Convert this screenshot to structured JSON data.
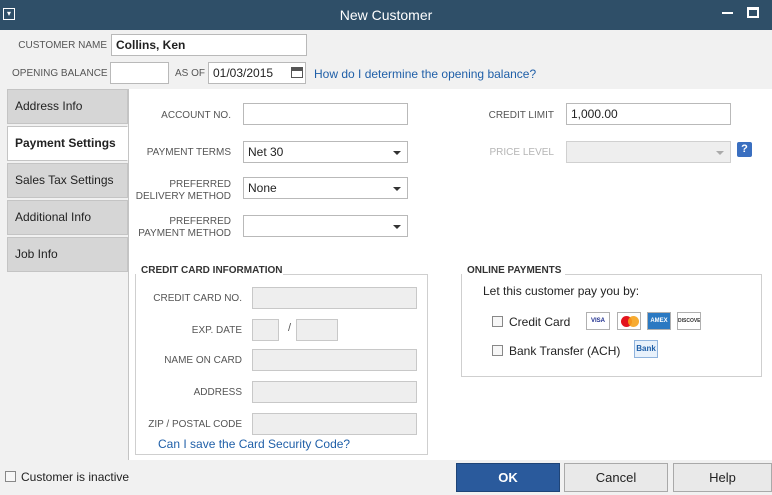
{
  "window": {
    "title": "New Customer"
  },
  "header": {
    "customer_name_label": "CUSTOMER NAME",
    "customer_name_value": "Collins, Ken",
    "opening_balance_label": "OPENING BALANCE",
    "opening_balance_value": "",
    "as_of_label": "AS OF",
    "as_of_value": "01/03/2015",
    "opening_balance_link": "How do I determine the opening balance?"
  },
  "tabs": [
    {
      "label": "Address Info"
    },
    {
      "label": "Payment Settings"
    },
    {
      "label": "Sales Tax Settings"
    },
    {
      "label": "Additional Info"
    },
    {
      "label": "Job Info"
    }
  ],
  "payment": {
    "account_no_label": "ACCOUNT NO.",
    "account_no_value": "",
    "credit_limit_label": "CREDIT LIMIT",
    "credit_limit_value": "1,000.00",
    "payment_terms_label": "PAYMENT TERMS",
    "payment_terms_value": "Net 30",
    "price_level_label": "PRICE LEVEL",
    "price_level_value": "",
    "pref_delivery_label_1": "PREFERRED",
    "pref_delivery_label_2": "DELIVERY METHOD",
    "pref_delivery_value": "None",
    "pref_payment_label_1": "PREFERRED",
    "pref_payment_label_2": "PAYMENT METHOD",
    "pref_payment_value": ""
  },
  "credit_card": {
    "section_title": "CREDIT CARD INFORMATION",
    "card_no_label": "CREDIT CARD NO.",
    "exp_date_label": "EXP. DATE",
    "exp_separator": "/",
    "name_on_card_label": "NAME ON CARD",
    "address_label": "ADDRESS",
    "zip_label": "ZIP / POSTAL CODE",
    "security_link": "Can I save the Card Security Code?"
  },
  "online_payments": {
    "section_title": "ONLINE PAYMENTS",
    "prompt": "Let this customer pay you by:",
    "credit_card_label": "Credit Card",
    "bank_transfer_label": "Bank Transfer (ACH)",
    "logos": {
      "visa": "VISA",
      "mastercard": "MasterCard",
      "amex": "AMEX",
      "discover": "DISCOVER",
      "bank": "Bank"
    }
  },
  "footer": {
    "inactive_label": "Customer is inactive",
    "ok_label": "OK",
    "cancel_label": "Cancel",
    "help_label": "Help"
  },
  "colors": {
    "titlebar": "#2f4f68",
    "primary_button": "#2a5a9c",
    "link": "#1f5fa8"
  },
  "icons": {
    "calendar": "calendar-icon",
    "help": "help-icon"
  }
}
